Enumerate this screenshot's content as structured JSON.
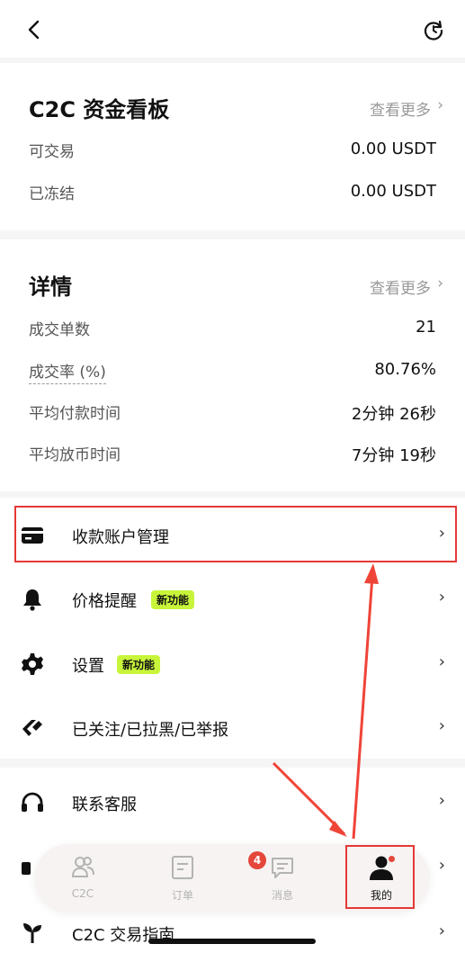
{
  "dashboard": {
    "title": "C2C 资金看板",
    "more": "查看更多",
    "rows": [
      {
        "label": "可交易",
        "value": "0.00 USDT"
      },
      {
        "label": "已冻结",
        "value": "0.00 USDT"
      }
    ]
  },
  "details": {
    "title": "详情",
    "more": "查看更多",
    "rows": [
      {
        "label": "成交单数",
        "value": "21"
      },
      {
        "label": "成交率 (%)",
        "value": "80.76%"
      },
      {
        "label": "平均付款时间",
        "value": "2分钟 26秒"
      },
      {
        "label": "平均放币时间",
        "value": "7分钟 19秒"
      }
    ]
  },
  "menu": {
    "items": [
      {
        "label": "收款账户管理",
        "icon": "card-icon"
      },
      {
        "label": "价格提醒",
        "icon": "bell-icon",
        "badge": "新功能"
      },
      {
        "label": "设置",
        "icon": "gear-icon",
        "badge": "新功能"
      },
      {
        "label": "已关注/已拉黑/已举报",
        "icon": "tag-icon"
      }
    ]
  },
  "menu2": {
    "items": [
      {
        "label": "联系客服",
        "icon": "headset-icon"
      },
      {
        "label": "C2C 交易指南",
        "icon": "sprout-icon"
      }
    ]
  },
  "tabbar": {
    "tabs": [
      {
        "label": "C2C",
        "icon": "people-icon"
      },
      {
        "label": "订单",
        "icon": "order-icon"
      },
      {
        "label": "消息",
        "icon": "message-icon",
        "badge": "4"
      },
      {
        "label": "我的",
        "icon": "user-icon"
      }
    ]
  },
  "colors": {
    "accent": "#c8f53a",
    "highlight": "#e53935",
    "badge": "#e5473b"
  }
}
